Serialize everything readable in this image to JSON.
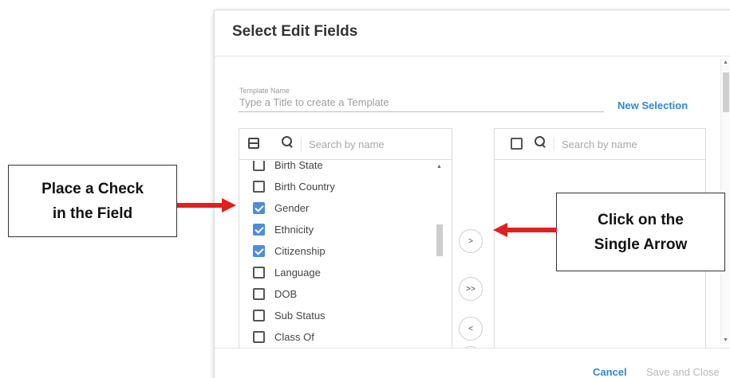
{
  "dialog": {
    "title": "Select Edit Fields",
    "template_name_label": "Template Name",
    "template_name_placeholder": "Type a Title to create a Template",
    "new_selection": "New Selection",
    "left_panel": {
      "search_placeholder": "Search by name",
      "items": [
        {
          "label": "Birth State",
          "checked": false
        },
        {
          "label": "Birth Country",
          "checked": false
        },
        {
          "label": "Gender",
          "checked": true
        },
        {
          "label": "Ethnicity",
          "checked": true
        },
        {
          "label": "Citizenship",
          "checked": true
        },
        {
          "label": "Language",
          "checked": false
        },
        {
          "label": "DOB",
          "checked": false
        },
        {
          "label": "Sub Status",
          "checked": false
        },
        {
          "label": "Class Of",
          "checked": false
        }
      ]
    },
    "right_panel": {
      "search_placeholder": "Search by name",
      "items": []
    },
    "buttons": {
      "move_right": ">",
      "move_all_right": ">>",
      "move_left": "<"
    },
    "footer": {
      "cancel": "Cancel",
      "save_close": "Save and Close"
    }
  },
  "annotations": {
    "left_callout": {
      "line1": "Place a Check",
      "line2": "in the Field"
    },
    "right_callout": {
      "line1": "Click on the",
      "line2": "Single Arrow"
    },
    "arrow_color": "#e02020"
  },
  "colors": {
    "accent": "#2f86d6",
    "checkbox_checked": "#4f8cdc"
  }
}
